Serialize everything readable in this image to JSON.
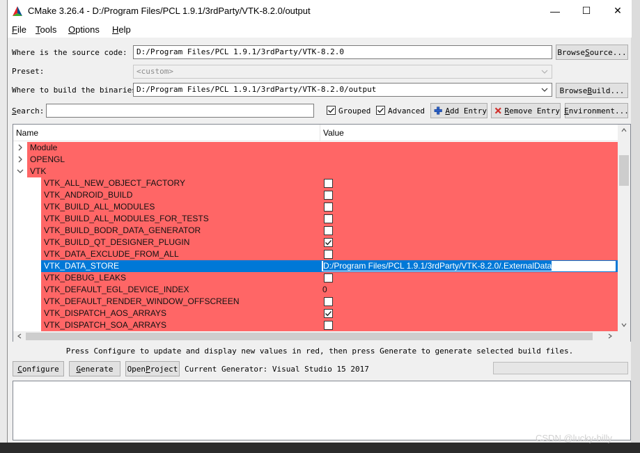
{
  "window": {
    "title": "CMake 3.26.4 - D:/Program Files/PCL 1.9.1/3rdParty/VTK-8.2.0/output",
    "minimize": "—",
    "maximize": "☐",
    "close": "✕"
  },
  "menu": [
    {
      "key": "F",
      "rest": "ile"
    },
    {
      "key": "T",
      "rest": "ools"
    },
    {
      "key": "O",
      "rest": "ptions"
    },
    {
      "key": "H",
      "rest": "elp"
    }
  ],
  "source": {
    "label": "Where is the source code:",
    "value": "D:/Program Files/PCL 1.9.1/3rdParty/VTK-8.2.0",
    "browse_pre": "Browse ",
    "browse_key": "S",
    "browse_post": "ource..."
  },
  "preset": {
    "label": "Preset:",
    "value": "<custom>"
  },
  "build": {
    "label": "Where to build the binaries:",
    "value": "D:/Program Files/PCL 1.9.1/3rdParty/VTK-8.2.0/output",
    "browse_pre": "Browse ",
    "browse_key": "B",
    "browse_post": "uild..."
  },
  "search": {
    "label_key": "S",
    "label_rest": "earch:",
    "value": "",
    "grouped_label": "Grouped",
    "grouped_checked": true,
    "advanced_label": "Advanced",
    "advanced_checked": true,
    "add_entry_key": "A",
    "add_entry_rest": "dd Entry",
    "remove_entry_key": "R",
    "remove_entry_rest": "emove Entry",
    "environment_key": "E",
    "environment_rest": "nvironment..."
  },
  "table": {
    "columns": {
      "name": "Name",
      "value": "Value"
    },
    "rows": [
      {
        "type": "group",
        "name": "Module",
        "expanded": false
      },
      {
        "type": "group",
        "name": "OPENGL",
        "expanded": false
      },
      {
        "type": "group",
        "name": "VTK",
        "expanded": true
      },
      {
        "type": "bool",
        "name": "VTK_ALL_NEW_OBJECT_FACTORY",
        "checked": false
      },
      {
        "type": "bool",
        "name": "VTK_ANDROID_BUILD",
        "checked": false
      },
      {
        "type": "bool",
        "name": "VTK_BUILD_ALL_MODULES",
        "checked": false
      },
      {
        "type": "bool",
        "name": "VTK_BUILD_ALL_MODULES_FOR_TESTS",
        "checked": false
      },
      {
        "type": "bool",
        "name": "VTK_BUILD_BODR_DATA_GENERATOR",
        "checked": false
      },
      {
        "type": "bool",
        "name": "VTK_BUILD_QT_DESIGNER_PLUGIN",
        "checked": true
      },
      {
        "type": "bool",
        "name": "VTK_DATA_EXCLUDE_FROM_ALL",
        "checked": false
      },
      {
        "type": "edit",
        "name": "VTK_DATA_STORE",
        "value": "D:/Program Files/PCL 1.9.1/3rdParty/VTK-8.2.0/.ExternalData",
        "selected": true
      },
      {
        "type": "bool",
        "name": "VTK_DEBUG_LEAKS",
        "checked": false
      },
      {
        "type": "text",
        "name": "VTK_DEFAULT_EGL_DEVICE_INDEX",
        "value": "0"
      },
      {
        "type": "bool",
        "name": "VTK_DEFAULT_RENDER_WINDOW_OFFSCREEN",
        "checked": false
      },
      {
        "type": "bool",
        "name": "VTK_DISPATCH_AOS_ARRAYS",
        "checked": true
      },
      {
        "type": "bool",
        "name": "VTK_DISPATCH_SOA_ARRAYS",
        "checked": false
      }
    ]
  },
  "hint": "Press Configure to update and display new values in red, then press Generate to generate selected build files.",
  "actions": {
    "configure_key": "C",
    "configure_rest": "onfigure",
    "generate_key": "G",
    "generate_rest": "enerate",
    "open_pre": "Open ",
    "open_key": "P",
    "open_post": "roject",
    "generator_label": "Current Generator: Visual Studio 15 2017"
  },
  "output_log": "",
  "watermark": "CSDN @lucky-billy",
  "colors": {
    "changed_row": "#ff6666",
    "selection": "#0078d7"
  }
}
